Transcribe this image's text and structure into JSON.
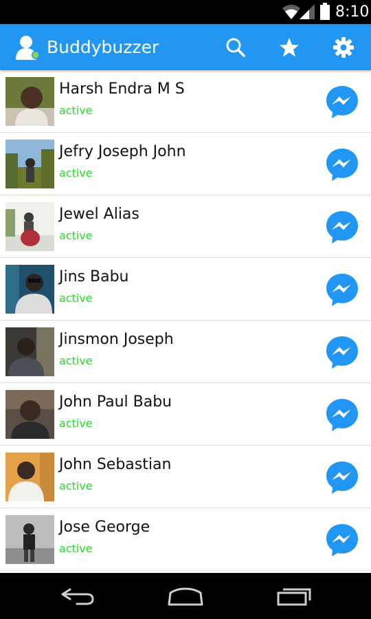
{
  "status_bar": {
    "time": "8:10",
    "icons": [
      "wifi-icon",
      "signal-icon",
      "battery-icon"
    ]
  },
  "app_bar": {
    "title": "Buddybuzzer",
    "app_icon": "person-icon",
    "actions": [
      "search-icon",
      "star-icon",
      "gear-icon"
    ],
    "color": "#2196f3"
  },
  "contacts": [
    {
      "name": "Harsh Endra M S",
      "status": "active"
    },
    {
      "name": "Jefry Joseph John",
      "status": "active"
    },
    {
      "name": "Jewel Alias",
      "status": "active"
    },
    {
      "name": "Jins Babu",
      "status": "active"
    },
    {
      "name": "Jinsmon Joseph",
      "status": "active"
    },
    {
      "name": "John Paul Babu",
      "status": "active"
    },
    {
      "name": "John Sebastian",
      "status": "active"
    },
    {
      "name": "Jose George",
      "status": "active"
    }
  ],
  "row_action_icon": "messenger-icon",
  "colors": {
    "status_active": "#22dd22",
    "messenger": "#2196f3"
  },
  "nav_bar": {
    "buttons": [
      "back-icon",
      "home-icon",
      "recents-icon"
    ]
  }
}
